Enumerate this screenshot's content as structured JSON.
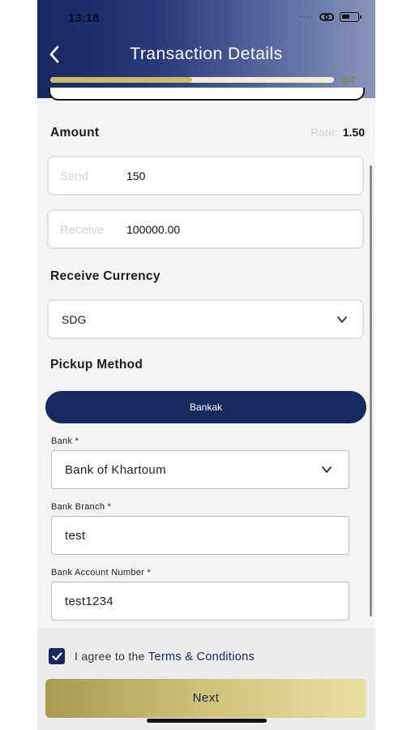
{
  "status_bar": {
    "time": "13:18"
  },
  "header": {
    "title": "Transaction Details",
    "step": "3/4",
    "progress": 0.5
  },
  "amount": {
    "label": "Amount",
    "rate_label": "Rate:",
    "rate_value": "1.50",
    "send_label": "Send",
    "send_value": "150",
    "receive_label": "Receive",
    "receive_value": "100000.00"
  },
  "currency": {
    "label": "Receive Currency",
    "selected": "SDG"
  },
  "pickup": {
    "label": "Pickup Method",
    "method": "Bankak"
  },
  "bank": {
    "bank_label": "Bank *",
    "bank_value": "Bank of Khartoum",
    "branch_label": "Bank Branch *",
    "branch_value": "test",
    "account_label": "Bank Account Number *",
    "account_value": "test1234"
  },
  "footer": {
    "agree_text": "I agree to the",
    "terms_link": "Terms & Conditions",
    "next_label": "Next"
  },
  "colors": {
    "navy": "#16295c",
    "gold": "#cfc27a"
  }
}
